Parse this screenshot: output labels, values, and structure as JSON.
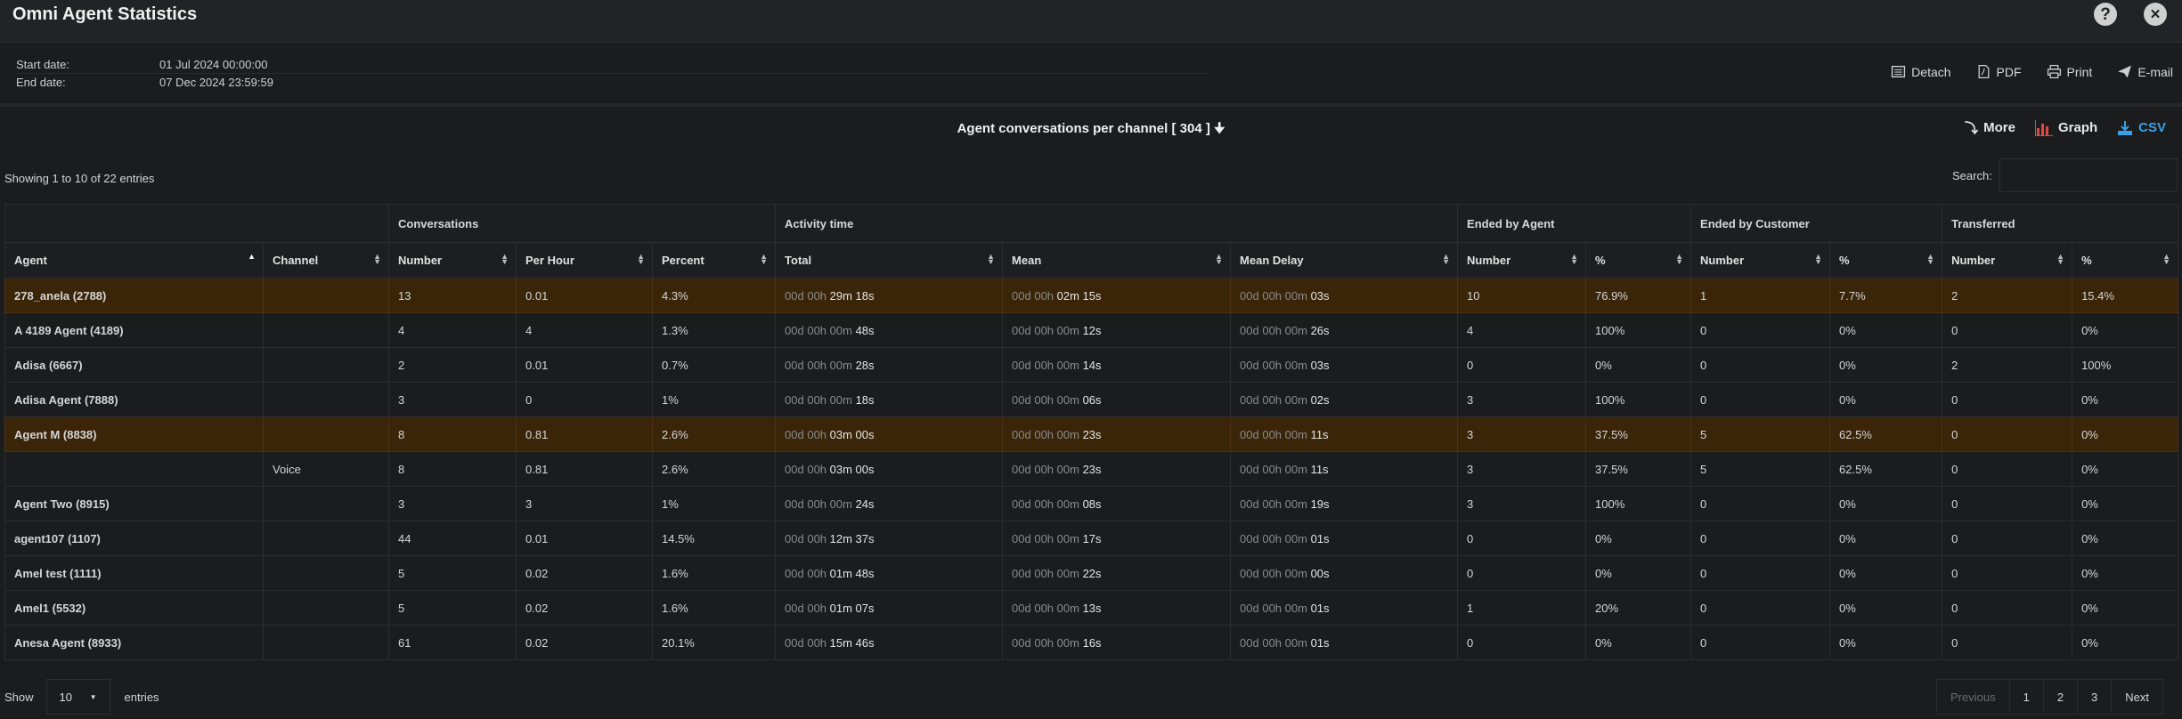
{
  "window": {
    "title": "Omni Agent Statistics",
    "help_label": "?",
    "close_label": "×"
  },
  "dates": {
    "start_label": "Start date:",
    "start_value": "01 Jul 2024 00:00:00",
    "end_label": "End date:",
    "end_value": "07 Dec 2024 23:59:59"
  },
  "tools": {
    "detach": "Detach",
    "pdf": "PDF",
    "print": "Print",
    "email": "E-mail"
  },
  "section_title": "Agent conversations per channel [ 304 ]",
  "actions": {
    "more": "More",
    "graph": "Graph",
    "csv": "CSV"
  },
  "info": "Showing 1 to 10 of 22 entries",
  "search": {
    "label": "Search:",
    "placeholder": ""
  },
  "table": {
    "groups": {
      "conversations": "Conversations",
      "activity": "Activity time",
      "ended_agent": "Ended by Agent",
      "ended_customer": "Ended by Customer",
      "transferred": "Transferred"
    },
    "columns": [
      "Agent",
      "Channel",
      "Number",
      "Per Hour",
      "Percent",
      "Total",
      "Mean",
      "Mean Delay",
      "Number",
      "%",
      "Number",
      "%",
      "Number",
      "%"
    ],
    "rows": [
      {
        "agent": "278_anela (2788)",
        "channel": "",
        "number": "13",
        "per_hour": "0.01",
        "percent": "4.3%",
        "total_dim": "00d 00h",
        "total_val": "29m 18s",
        "mean_dim": "00d 00h",
        "mean_val": "02m 15s",
        "delay_dim": "00d 00h 00m",
        "delay_val": "03s",
        "ea_num": "10",
        "ea_pct": "76.9%",
        "ec_num": "1",
        "ec_pct": "7.7%",
        "tr_num": "2",
        "tr_pct": "15.4%",
        "highlight": true
      },
      {
        "agent": "A 4189 Agent (4189)",
        "channel": "",
        "number": "4",
        "per_hour": "4",
        "percent": "1.3%",
        "total_dim": "00d 00h 00m",
        "total_val": "48s",
        "mean_dim": "00d 00h 00m",
        "mean_val": "12s",
        "delay_dim": "00d 00h 00m",
        "delay_val": "26s",
        "ea_num": "4",
        "ea_pct": "100%",
        "ec_num": "0",
        "ec_pct": "0%",
        "tr_num": "0",
        "tr_pct": "0%",
        "highlight": false
      },
      {
        "agent": "Adisa (6667)",
        "channel": "",
        "number": "2",
        "per_hour": "0.01",
        "percent": "0.7%",
        "total_dim": "00d 00h 00m",
        "total_val": "28s",
        "mean_dim": "00d 00h 00m",
        "mean_val": "14s",
        "delay_dim": "00d 00h 00m",
        "delay_val": "03s",
        "ea_num": "0",
        "ea_pct": "0%",
        "ec_num": "0",
        "ec_pct": "0%",
        "tr_num": "2",
        "tr_pct": "100%",
        "highlight": false
      },
      {
        "agent": "Adisa Agent (7888)",
        "channel": "",
        "number": "3",
        "per_hour": "0",
        "percent": "1%",
        "total_dim": "00d 00h 00m",
        "total_val": "18s",
        "mean_dim": "00d 00h 00m",
        "mean_val": "06s",
        "delay_dim": "00d 00h 00m",
        "delay_val": "02s",
        "ea_num": "3",
        "ea_pct": "100%",
        "ec_num": "0",
        "ec_pct": "0%",
        "tr_num": "0",
        "tr_pct": "0%",
        "highlight": false
      },
      {
        "agent": "Agent M (8838)",
        "channel": "",
        "number": "8",
        "per_hour": "0.81",
        "percent": "2.6%",
        "total_dim": "00d 00h",
        "total_val": "03m 00s",
        "mean_dim": "00d 00h 00m",
        "mean_val": "23s",
        "delay_dim": "00d 00h 00m",
        "delay_val": "11s",
        "ea_num": "3",
        "ea_pct": "37.5%",
        "ec_num": "5",
        "ec_pct": "62.5%",
        "tr_num": "0",
        "tr_pct": "0%",
        "highlight": true
      },
      {
        "agent": "",
        "channel": "Voice",
        "number": "8",
        "per_hour": "0.81",
        "percent": "2.6%",
        "total_dim": "00d 00h",
        "total_val": "03m 00s",
        "mean_dim": "00d 00h 00m",
        "mean_val": "23s",
        "delay_dim": "00d 00h 00m",
        "delay_val": "11s",
        "ea_num": "3",
        "ea_pct": "37.5%",
        "ec_num": "5",
        "ec_pct": "62.5%",
        "tr_num": "0",
        "tr_pct": "0%",
        "highlight": false
      },
      {
        "agent": "Agent Two (8915)",
        "channel": "",
        "number": "3",
        "per_hour": "3",
        "percent": "1%",
        "total_dim": "00d 00h 00m",
        "total_val": "24s",
        "mean_dim": "00d 00h 00m",
        "mean_val": "08s",
        "delay_dim": "00d 00h 00m",
        "delay_val": "19s",
        "ea_num": "3",
        "ea_pct": "100%",
        "ec_num": "0",
        "ec_pct": "0%",
        "tr_num": "0",
        "tr_pct": "0%",
        "highlight": false
      },
      {
        "agent": "agent107 (1107)",
        "channel": "",
        "number": "44",
        "per_hour": "0.01",
        "percent": "14.5%",
        "total_dim": "00d 00h",
        "total_val": "12m 37s",
        "mean_dim": "00d 00h 00m",
        "mean_val": "17s",
        "delay_dim": "00d 00h 00m",
        "delay_val": "01s",
        "ea_num": "0",
        "ea_pct": "0%",
        "ec_num": "0",
        "ec_pct": "0%",
        "tr_num": "0",
        "tr_pct": "0%",
        "highlight": false
      },
      {
        "agent": "Amel test (1111)",
        "channel": "",
        "number": "5",
        "per_hour": "0.02",
        "percent": "1.6%",
        "total_dim": "00d 00h",
        "total_val": "01m 48s",
        "mean_dim": "00d 00h 00m",
        "mean_val": "22s",
        "delay_dim": "00d 00h 00m",
        "delay_val": "00s",
        "ea_num": "0",
        "ea_pct": "0%",
        "ec_num": "0",
        "ec_pct": "0%",
        "tr_num": "0",
        "tr_pct": "0%",
        "highlight": false
      },
      {
        "agent": "Amel1 (5532)",
        "channel": "",
        "number": "5",
        "per_hour": "0.02",
        "percent": "1.6%",
        "total_dim": "00d 00h",
        "total_val": "01m 07s",
        "mean_dim": "00d 00h 00m",
        "mean_val": "13s",
        "delay_dim": "00d 00h 00m",
        "delay_val": "01s",
        "ea_num": "1",
        "ea_pct": "20%",
        "ec_num": "0",
        "ec_pct": "0%",
        "tr_num": "0",
        "tr_pct": "0%",
        "highlight": false
      },
      {
        "agent": "Anesa Agent (8933)",
        "channel": "",
        "number": "61",
        "per_hour": "0.02",
        "percent": "20.1%",
        "total_dim": "00d 00h",
        "total_val": "15m 46s",
        "mean_dim": "00d 00h 00m",
        "mean_val": "16s",
        "delay_dim": "00d 00h 00m",
        "delay_val": "01s",
        "ea_num": "0",
        "ea_pct": "0%",
        "ec_num": "0",
        "ec_pct": "0%",
        "tr_num": "0",
        "tr_pct": "0%",
        "highlight": false
      }
    ]
  },
  "footer": {
    "show_label": "Show",
    "page_size": "10",
    "entries_label": "entries",
    "pagination": {
      "previous": "Previous",
      "pages": [
        "1",
        "2",
        "3"
      ],
      "next": "Next"
    }
  },
  "colors": {
    "highlight_row": "#3a2508",
    "csv_accent": "#3aa0e6",
    "graph_icon": "#e0463e"
  }
}
